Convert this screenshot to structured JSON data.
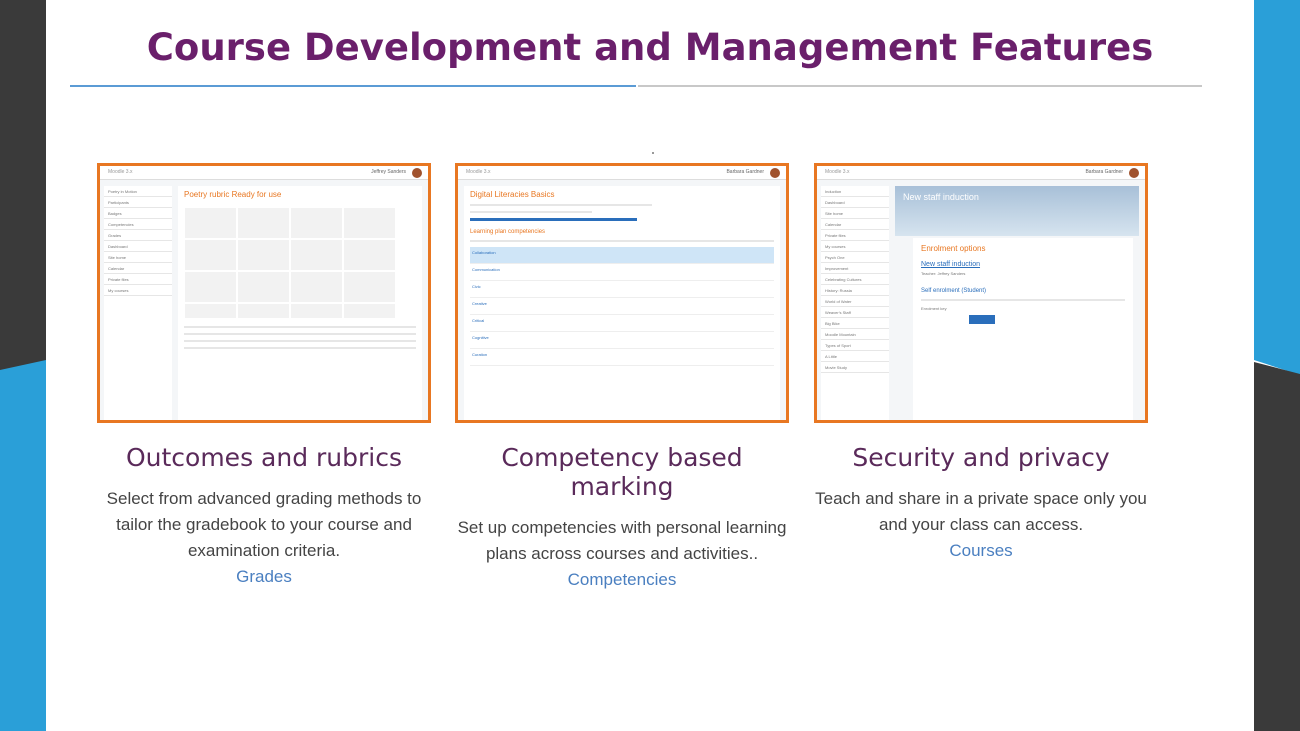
{
  "slide": {
    "title": "Course Development and Management Features"
  },
  "colors": {
    "title": "#6a1f6b",
    "accent_orange": "#e87722",
    "side_blue": "#2a9fd8",
    "side_dark": "#3a3a3a",
    "link": "#4a7fc0"
  },
  "cards": [
    {
      "heading": "Outcomes and rubrics",
      "description": "Select from advanced grading methods to tailor the gradebook to your course and examination criteria.",
      "link": "Grades",
      "screenshot": {
        "heading": "Poetry rubric Ready for use",
        "topbar": "Moodle 3.x",
        "user": "Jeffrey Sanders",
        "nav": [
          "Poetry in Motion",
          "Participants",
          "Badges",
          "Competencies",
          "Grades",
          "Dashboard",
          "Site home",
          "Calendar",
          "Private files",
          "My courses"
        ]
      }
    },
    {
      "heading": "Competency based marking",
      "description": "Set up competencies with personal learning plans across courses and activities..",
      "link": "Competencies",
      "screenshot": {
        "heading": "Digital Literacies Basics",
        "sub": "Learning plan competencies",
        "topbar": "Moodle 3.x",
        "user": "Barbara Gardner",
        "rows": [
          "Collaboration",
          "Communication",
          "Civic",
          "Creative",
          "Critical",
          "Cognitive",
          "Curation"
        ]
      }
    },
    {
      "heading": "Security and privacy",
      "description": "Teach and share in a private space only you and your class can access.",
      "link": "Courses",
      "screenshot": {
        "heading": "New staff induction",
        "panel_title": "Enrolment options",
        "course": "New staff induction",
        "teacher": "Teacher: Jeffrey Sanders",
        "section": "Self enrolment (Student)",
        "enrol_key": "Enrolment key",
        "topbar": "Moodle 3.x",
        "user": "Barbara Gardner",
        "nav": [
          "Induction",
          "Dashboard",
          "Site home",
          "Calendar",
          "Private files",
          "My courses",
          "Psych One",
          "Improvement",
          "Celebrating Cultures",
          "History: Russia",
          "World of Water",
          "Weaver's Staff",
          "Big Bike",
          "Moodle Mountain",
          "Types of Sport",
          "A Little",
          "Movie Study"
        ]
      }
    }
  ]
}
